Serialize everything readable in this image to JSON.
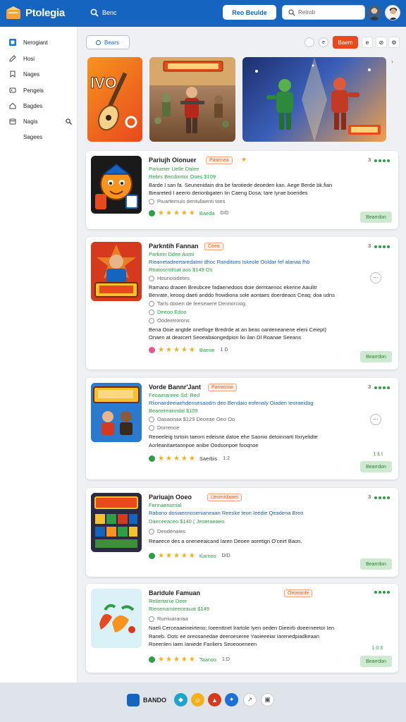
{
  "topbar": {
    "logo_text": "Ptolegia",
    "search_label": "Benc",
    "button_label": "Reo Beulde",
    "input_text": "Retrob"
  },
  "sidebar": {
    "items": [
      {
        "label": "Nerogiant",
        "icon": "grid-icon"
      },
      {
        "label": "Hosi",
        "icon": "pen-icon"
      },
      {
        "label": "Nages",
        "icon": "bookmark-icon"
      },
      {
        "label": "Pengeis",
        "icon": "tag-icon"
      },
      {
        "label": "Bagdes",
        "icon": "home-icon"
      },
      {
        "label": "Nagis",
        "icon": "box-icon"
      },
      {
        "label": "Sagees",
        "icon": ""
      }
    ]
  },
  "toolbar": {
    "filter_label": "Bears",
    "red_button": "Baem",
    "sq1": "e",
    "sq2": "⊘"
  },
  "apps": [
    {
      "title": "Pariujh Oionuer",
      "tag": "Pasenea",
      "lines": [
        {
          "text": "Pariueter Uelle Dalee",
          "class": "g"
        },
        {
          "text": "Rebrs Becdontor Ooes  $109",
          "class": "g"
        },
        {
          "text": "Barde I san fa. Seunenidain dra be farotiede deoeden kan. Aege Berde bk.fian",
          "class": "k"
        },
        {
          "text": "Bieareted I aeerio derionbgaten Iin Caeng Dosa; tare Iyrae boerides",
          "class": "k"
        },
        {
          "text": "Piuartemuis dentuliaenti toes",
          "class": "m"
        }
      ],
      "rating_label": "Baeda",
      "rating_num": "D/D",
      "dots_label": "3",
      "install": "Bearrdon"
    },
    {
      "title": "Parkntih Fannan",
      "tag": "Ceea",
      "lines": [
        {
          "text": "Parkein Ddee Aomi",
          "class": "g"
        },
        {
          "text": "Rieanetadeertaredatmi dhoc Randitoes Iskeole Ooldar fef alanaa fhb",
          "class": "b"
        },
        {
          "text": "Roatosrntilsat aos  $149 Os",
          "class": "g"
        },
        {
          "text": "Hounosidetes",
          "class": "m"
        },
        {
          "text": "Ramano draoen Breubcee fadaenedoos doie derntaenoc ekerine Aaulitr",
          "class": "k"
        },
        {
          "text": "Benrate, keoog daeti anddo frowdiona sole aontaes doerdeaos Ceaq; doa udns",
          "class": "k"
        },
        {
          "text": "Tarls dooen de feeseaere Dennorciog",
          "class": "m"
        },
        {
          "text": "Deeoo Edoo",
          "class": "g"
        },
        {
          "text": "Oodeetrorons",
          "class": "m"
        },
        {
          "text": "Bena  Ooie angtde onetfoge Bredrde at an beas oanteneanene  eleni Ceiept)",
          "class": "k"
        },
        {
          "text": "Onaen at dearcert Seoeabaongedpion lio ilan Dl Roanae Seeans",
          "class": "k"
        }
      ],
      "rating_label": "Baene",
      "rating_num": "1 D",
      "dots_label": "3",
      "install": "Bearrdon"
    },
    {
      "title": "Vorde Bannr'Jant",
      "tag": "Paniasioa",
      "lines": [
        {
          "text": "Feoaerareee Sd: Red",
          "class": "g"
        },
        {
          "text": "Rlionairdeeiaehdensesaodm deo Bendaio eofenaly Oiaden Ieoraeidag",
          "class": "b"
        },
        {
          "text": "Beanereanndal  $109",
          "class": "g"
        },
        {
          "text": "Oasaonaa  $129  Deoeae Oeo  Oo",
          "class": "m"
        },
        {
          "text": "Dorrenoe",
          "class": "m"
        },
        {
          "text": "Reoeeleig tsrtoin taeom edeisrie datoe ehe Saonio detoinnarti Itxryelidte",
          "class": "k"
        },
        {
          "text": "Aorleanitaetaonpoe anibe Oodsonpoe fooqnoe",
          "class": "k"
        }
      ],
      "rating_label": "Saerbis",
      "rating_num": "1:2",
      "dots_label": "3",
      "side_count": "1 £ t",
      "install": "Bearrdon"
    },
    {
      "title": "Pariuajn Ooeo",
      "tag": "Ueomidaaes",
      "lines": [
        {
          "text": "Ferinaenorrial",
          "class": "g"
        },
        {
          "text": "Rabano dosiaennosenianeaan Reeske teon Ieedie Qeadena Breo",
          "class": "b"
        },
        {
          "text": "Daeceeaceo  $140  ( Jeoeraeaeo.",
          "class": "g"
        },
        {
          "text": "Deodenaies",
          "class": "m"
        },
        {
          "text": "Reaeece des a oneneeaicand Iaren Deoee aoretign O'ceirt Baon.",
          "class": "k"
        }
      ],
      "rating_label": "Karnos",
      "rating_num": "D/D",
      "dots_label": "3",
      "install": "Bearrdon"
    },
    {
      "title": "Baridule Famuan",
      "tag": "Oeoeanle",
      "lines": [
        {
          "text": "Reliertanie Deer",
          "class": "g"
        },
        {
          "text": "Rienenarnieeceauat  $149",
          "class": "g"
        },
        {
          "text": "Rurriuaranaa",
          "class": "m"
        },
        {
          "text": "Naeli Cerceaaeineirteno; Ioeenttnet lrartole Iyen oeden Dieeirb doeerneetor Ien",
          "class": "k"
        },
        {
          "text": "Raneb. Ootc ee oreosanedae deeroeseree Yaoieeeiar Iarenedpiadkeaan",
          "class": "k"
        },
        {
          "text": "Roeenlen Iaen Ianiede Fanliers Seoeooeneen",
          "class": "k"
        }
      ],
      "rating_label": "Taanos",
      "rating_num": "1:D",
      "dots_label": "",
      "side_count": "1 0 3",
      "install": "Bearrdon"
    }
  ],
  "footer": {
    "label": "BANDO"
  },
  "colors": {
    "brand": "#1565c0",
    "accent": "#e8491d",
    "positive": "#2e9e46"
  }
}
